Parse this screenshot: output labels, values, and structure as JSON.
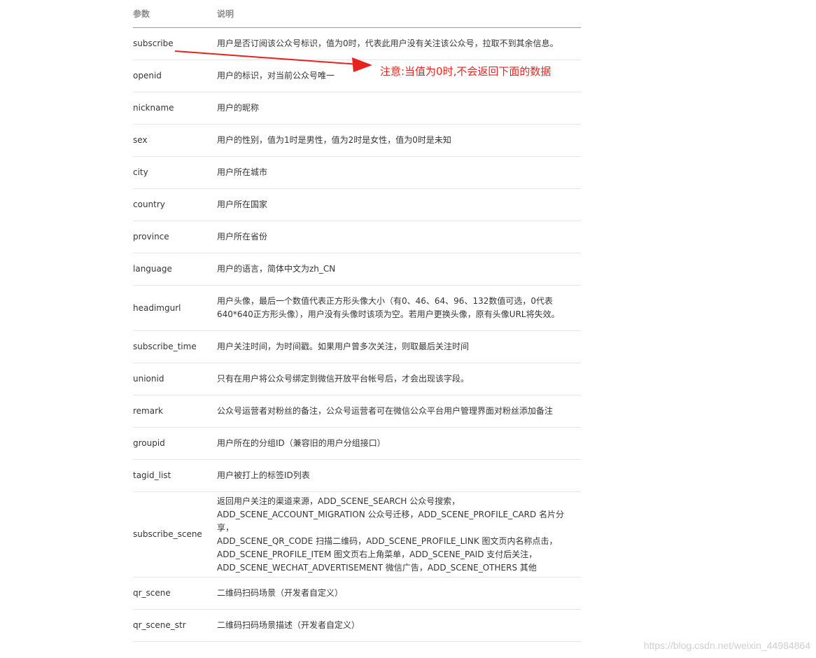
{
  "header": {
    "param": "参数",
    "desc": "说明"
  },
  "rows": [
    {
      "param": "subscribe",
      "desc": "用户是否订阅该公众号标识，值为0时，代表此用户没有关注该公众号，拉取不到其余信息。"
    },
    {
      "param": "openid",
      "desc": "用户的标识，对当前公众号唯一"
    },
    {
      "param": "nickname",
      "desc": "用户的昵称"
    },
    {
      "param": "sex",
      "desc": "用户的性别，值为1时是男性，值为2时是女性，值为0时是未知"
    },
    {
      "param": "city",
      "desc": "用户所在城市"
    },
    {
      "param": "country",
      "desc": "用户所在国家"
    },
    {
      "param": "province",
      "desc": "用户所在省份"
    },
    {
      "param": "language",
      "desc": "用户的语言，简体中文为zh_CN"
    },
    {
      "param": "headimgurl",
      "desc": "用户头像，最后一个数值代表正方形头像大小（有0、46、64、96、132数值可选，0代表\n640*640正方形头像），用户没有头像时该项为空。若用户更换头像，原有头像URL将失效。"
    },
    {
      "param": "subscribe_time",
      "desc": "用户关注时间，为时间戳。如果用户曾多次关注，则取最后关注时间"
    },
    {
      "param": "unionid",
      "desc": "只有在用户将公众号绑定到微信开放平台帐号后，才会出现该字段。"
    },
    {
      "param": "remark",
      "desc": "公众号运营者对粉丝的备注，公众号运营者可在微信公众平台用户管理界面对粉丝添加备注"
    },
    {
      "param": "groupid",
      "desc": "用户所在的分组ID（兼容旧的用户分组接口）"
    },
    {
      "param": "tagid_list",
      "desc": "用户被打上的标签ID列表"
    },
    {
      "param": "subscribe_scene",
      "desc": "返回用户关注的渠道来源，ADD_SCENE_SEARCH 公众号搜索，\nADD_SCENE_ACCOUNT_MIGRATION 公众号迁移，ADD_SCENE_PROFILE_CARD 名片分享，\nADD_SCENE_QR_CODE 扫描二维码，ADD_SCENE_PROFILE_LINK 图文页内名称点击，\nADD_SCENE_PROFILE_ITEM 图文页右上角菜单，ADD_SCENE_PAID 支付后关注，\nADD_SCENE_WECHAT_ADVERTISEMENT 微信广告，ADD_SCENE_OTHERS 其他"
    },
    {
      "param": "qr_scene",
      "desc": "二维码扫码场景（开发者自定义）"
    },
    {
      "param": "qr_scene_str",
      "desc": "二维码扫码场景描述（开发者自定义）"
    }
  ],
  "annotation": {
    "text": "注意:当值为0时,不会返回下面的数据",
    "color": "#e8231f"
  },
  "watermark": "https://blog.csdn.net/weixin_44984864"
}
